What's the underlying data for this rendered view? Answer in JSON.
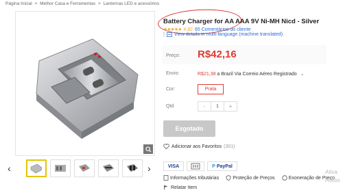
{
  "breadcrumb": [
    "Página Inicial",
    ">",
    "Melhor Casa e Ferramentas",
    ">",
    "Lanternas LED e acessórios"
  ],
  "product": {
    "title": "Battery Charger for AA AAA 9V Ni-MH Nicd - Silver",
    "stars": "★★★★★",
    "rating": "4.82",
    "reviews": "65 Comentários do cliente",
    "multilang": "View details in multi-language (machine translated)"
  },
  "price": {
    "label": "Preço:",
    "value": "R$42,16"
  },
  "shipping": {
    "label": "Envio:",
    "cost": "R$21,38",
    "text": " a Brazil Via Correio Aéreo Registrado"
  },
  "color": {
    "label": "Cor:",
    "value": "Prata"
  },
  "quantity": {
    "label": "Qtd",
    "value": "1",
    "minus": "-",
    "plus": "+"
  },
  "soldout_label": "Esgotado",
  "favorites": {
    "label": "Adicionar aos Favoritos",
    "count": "(301)"
  },
  "payments": [
    "VISA",
    "PayPal"
  ],
  "features": [
    "Informações tributárias",
    "Proteção de Preços",
    "Exoneração de Preço"
  ],
  "report": "Relatar Item",
  "watermark": [
    "Ativa",
    "Acess"
  ],
  "colors": {
    "price": "#e03a2f",
    "link": "#2a6ad6",
    "star": "#f5a623",
    "annotation": "#d33"
  }
}
